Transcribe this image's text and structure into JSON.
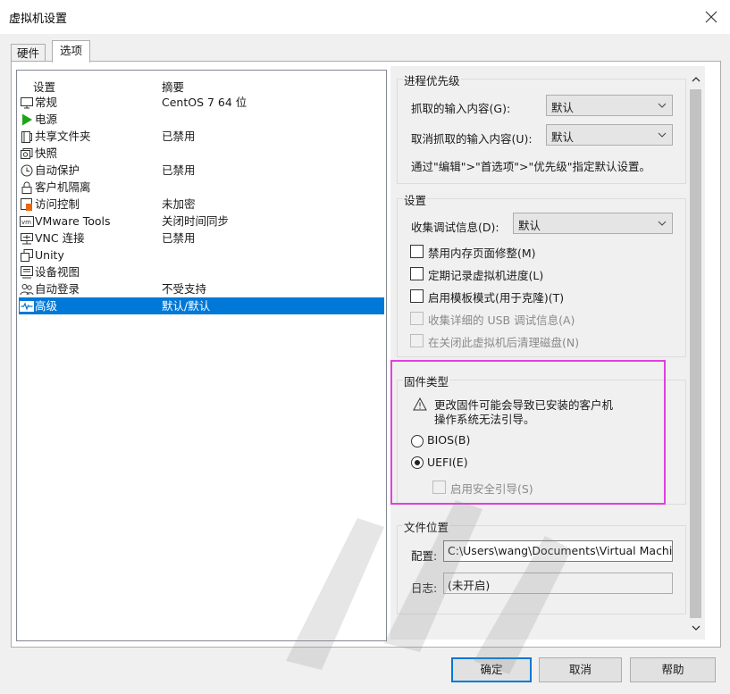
{
  "window": {
    "title": "虚拟机设置"
  },
  "tabs": [
    {
      "label": "硬件"
    },
    {
      "label": "选项"
    }
  ],
  "list": {
    "header_setting": "设置",
    "header_summary": "摘要",
    "items": [
      {
        "label": "常规",
        "summary": "CentOS 7 64 位",
        "icon": "monitor-icon"
      },
      {
        "label": "电源",
        "summary": "",
        "icon": "play-icon"
      },
      {
        "label": "共享文件夹",
        "summary": "已禁用",
        "icon": "shared-folder-icon"
      },
      {
        "label": "快照",
        "summary": "",
        "icon": "snapshot-icon"
      },
      {
        "label": "自动保护",
        "summary": "已禁用",
        "icon": "clock-icon"
      },
      {
        "label": "客户机隔离",
        "summary": "",
        "icon": "lock-icon"
      },
      {
        "label": "访问控制",
        "summary": "未加密",
        "icon": "access-control-icon"
      },
      {
        "label": "VMware Tools",
        "summary": "关闭时间同步",
        "icon": "vm-icon"
      },
      {
        "label": "VNC 连接",
        "summary": "已禁用",
        "icon": "network-icon"
      },
      {
        "label": "Unity",
        "summary": "",
        "icon": "unity-icon"
      },
      {
        "label": "设备视图",
        "summary": "",
        "icon": "device-view-icon"
      },
      {
        "label": "自动登录",
        "summary": "不受支持",
        "icon": "users-icon"
      },
      {
        "label": "高级",
        "summary": "默认/默认",
        "icon": "pulse-icon"
      }
    ]
  },
  "process_priority": {
    "caption": "进程优先级",
    "grab_label": "抓取的输入内容(G):",
    "grab_value": "默认",
    "ungrab_label": "取消抓取的输入内容(U):",
    "ungrab_value": "默认",
    "hint": "通过\"编辑\">\"首选项\">\"优先级\"指定默认设置。"
  },
  "settings": {
    "caption": "设置",
    "debug_label": "收集调试信息(D):",
    "debug_value": "默认",
    "checkboxes": [
      {
        "label": "禁用内存页面修整(M)",
        "checked": false,
        "enabled": true
      },
      {
        "label": "定期记录虚拟机进度(L)",
        "checked": false,
        "enabled": true
      },
      {
        "label": "启用模板模式(用于克隆)(T)",
        "checked": false,
        "enabled": true
      },
      {
        "label": "收集详细的 USB 调试信息(A)",
        "checked": false,
        "enabled": false
      },
      {
        "label": "在关闭此虚拟机后清理磁盘(N)",
        "checked": false,
        "enabled": false
      }
    ]
  },
  "firmware": {
    "caption": "固件类型",
    "warning_line1": "更改固件可能会导致已安装的客户机",
    "warning_line2": "操作系统无法引导。",
    "bios_label": "BIOS(B)",
    "uefi_label": "UEFI(E)",
    "selected": "UEFI",
    "secure_boot_label": "启用安全引导(S)"
  },
  "file_location": {
    "caption": "文件位置",
    "config_label": "配置:",
    "config_value": "C:\\Users\\wang\\Documents\\Virtual Machin",
    "log_label": "日志:",
    "log_value": "(未开启)"
  },
  "buttons": {
    "ok": "确定",
    "cancel": "取消",
    "help": "帮助"
  },
  "colors": {
    "selection": "#0078d7",
    "highlight_border": "#e040e0",
    "power_icon": "#1fa319"
  }
}
